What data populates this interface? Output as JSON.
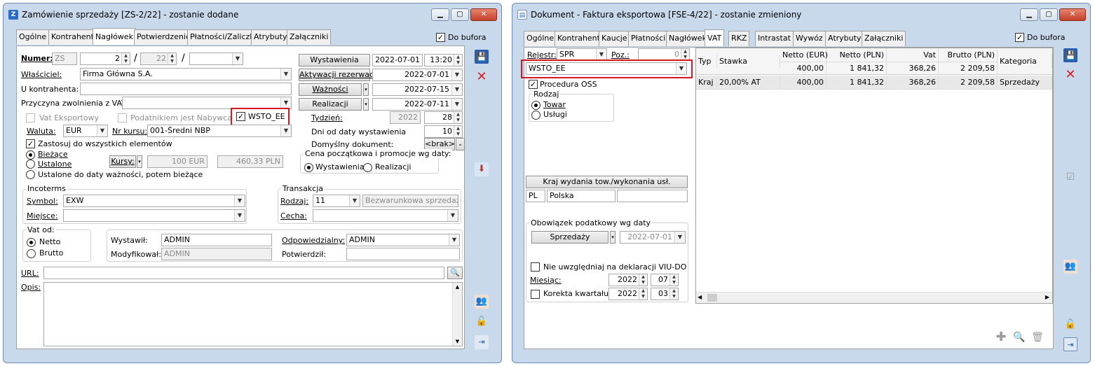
{
  "left": {
    "title": "Zamówienie sprzedaży [ZS-2/22] - zostanie dodane",
    "tabs": [
      "Ogólne",
      "Kontrahent",
      "Nagłówek",
      "Potwierdzenie",
      "Płatności/Zaliczki",
      "Atrybuty",
      "Załączniki"
    ],
    "do_bufora": "Do bufora",
    "numer_label": "Numer:",
    "numer_prefix": "ZS",
    "numer_val": "2",
    "numer_year": "22",
    "slash": "/",
    "wlasciciel_label": "Właściciel:",
    "wlasciciel_val": "Firma Główna S.A.",
    "u_kontrahenta_label": "U kontrahenta:",
    "przyczyna_label": "Przyczyna zwolnienia z VAT:",
    "vat_eksportowy": "Vat Eksportowy",
    "podatnikiem": "Podatnikiem jest Nabywca",
    "wsto": "WSTO_EE",
    "waluta_label": "Waluta:",
    "waluta_val": "EUR",
    "nr_kursu_label": "Nr kursu:",
    "nr_kursu_val": "001-Średni NBP",
    "zastosuj": "Zastosuj do wszystkich elementów",
    "biezace": "Bieżące",
    "ustalone": "Ustalone",
    "ustalone_do": "Ustalone do daty ważności, potem bieżące",
    "kursy_label": "Kursy:",
    "kurs_eur": "100 EUR",
    "kurs_pln": "460,33 PLN",
    "wystawienia_btn": "Wystawienia",
    "wystawienia_date": "2022-07-01",
    "wystawienia_time": "13:20",
    "aktywacji_btn": "Aktywacji rezerwacji",
    "aktywacji_date": "2022-07-01",
    "waznosci_btn": "Ważności",
    "waznosci_date": "2022-07-15",
    "realizacji_btn": "Realizacji",
    "realizacji_date": "2022-07-11",
    "tydzien_label": "Tydzień:",
    "tydzien_year": "2022",
    "tydzien_val": "28",
    "dni_label": "Dni od daty wystawienia",
    "dni_val": "10",
    "domyslny_label": "Domyślny dokument:",
    "domyslny_val": "<brak>",
    "cena_label": "Cena początkowa i promocje wg daty:",
    "cena_wyst": "Wystawienia",
    "cena_real": "Realizacji",
    "incoterms": "Incoterms",
    "symbol_label": "Symbol:",
    "symbol_val": "EXW",
    "miejsce_label": "Miejsce:",
    "transakcja": "Transakcja",
    "rodzaj_label": "Rodzaj:",
    "rodzaj_val": "11",
    "rodzaj_desc": "Bezwarunkowa sprzedaż/ki",
    "cecha_label": "Cecha:",
    "vat_od": "Vat od:",
    "netto": "Netto",
    "brutto": "Brutto",
    "wystawil_label": "Wystawił:",
    "wystawil_val": "ADMIN",
    "modyfikowal_label": "Modyfikował:",
    "modyfikowal_val": "ADMIN",
    "odpowiedzialny_label": "Odpowiedzialny:",
    "odpowiedzialny_val": "ADMIN",
    "potwierdzil_label": "Potwierdził:",
    "url_label": "URL:",
    "opis_label": "Opis:"
  },
  "right": {
    "title": "Dokument - Faktura eksportowa [FSE-4/22] - zostanie zmieniony",
    "tabs": [
      "Ogólne",
      "Kontrahent",
      "Kaucje",
      "Płatności",
      "Nagłówek",
      "VAT",
      "RKZ",
      "Intrastat",
      "Wywóz",
      "Atrybuty",
      "Załączniki"
    ],
    "do_bufora": "Do bufora",
    "rejestr_label": "Rejestr:",
    "rejestr_val": "SPR",
    "poz_label": "Poz.:",
    "poz_val": "0",
    "wsto": "WSTO_EE",
    "procedura": "Procedura OSS",
    "rodzaj": "Rodzaj",
    "towar": "Towar",
    "uslugi": "Usługi",
    "kraj_btn": "Kraj wydania tow./wykonania usł.",
    "kraj_code": "PL",
    "kraj_name": "Polska",
    "obowiazek": "Obowiązek podatkowy wg daty",
    "sprzedazy_btn": "Sprzedaży",
    "obow_date": "2022-07-01",
    "nie_uwzgl": "Nie uwzględniaj na deklaracji VIU-DO",
    "miesiac_label": "Miesiąc:",
    "miesiac_year": "2022",
    "miesiac_val": "07",
    "korekta_label": "Korekta kwartału",
    "korekta_year": "2022",
    "korekta_val": "03",
    "grid": {
      "headers": [
        "Typ",
        "Stawka",
        "Netto (EUR)",
        "Netto (PLN)",
        "Vat",
        "Brutto (PLN)",
        "Kategoria"
      ],
      "totals": [
        "400,00",
        "1 841,32",
        "368,26",
        "2 209,58"
      ],
      "row": [
        "Kraj",
        "20,00% AT",
        "400,00",
        "1 841,32",
        "368,26",
        "2 209,58",
        "Sprzedaży"
      ]
    }
  }
}
